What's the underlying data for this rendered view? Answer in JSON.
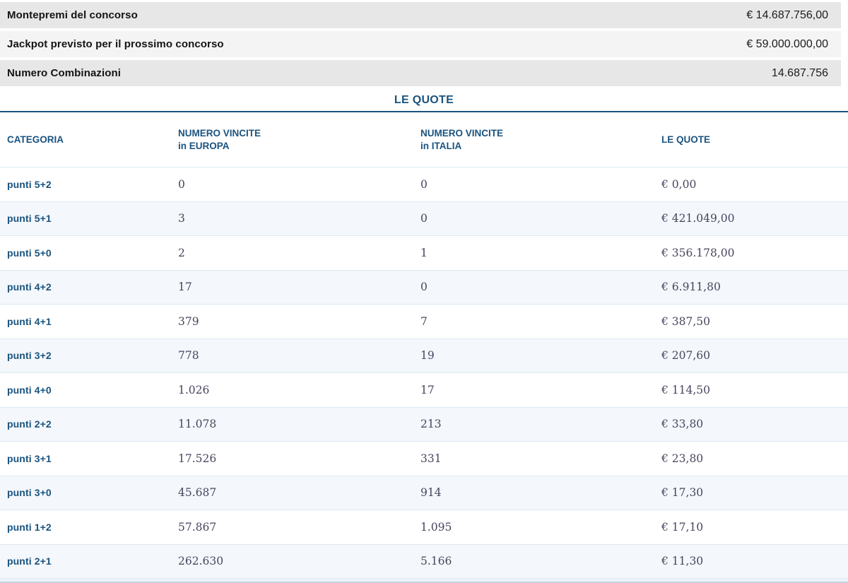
{
  "summary": {
    "rows": [
      {
        "label": "Montepremi del concorso",
        "value": "€ 14.687.756,00"
      },
      {
        "label": "Jackpot previsto per il prossimo concorso",
        "value": "€ 59.000.000,00"
      },
      {
        "label": "Numero Combinazioni",
        "value": "14.687.756"
      }
    ]
  },
  "quote_section": {
    "title": "LE QUOTE",
    "table": {
      "headers": [
        {
          "line1": "CATEGORIA",
          "line2": ""
        },
        {
          "line1": "NUMERO VINCITE",
          "line2": "in EUROPA"
        },
        {
          "line1": "NUMERO VINCITE",
          "line2": "in ITALIA"
        },
        {
          "line1": "LE QUOTE",
          "line2": ""
        }
      ],
      "rows": [
        {
          "categoria": "punti 5+2",
          "europa": "0",
          "italia": "0",
          "quota": "€ 0,00"
        },
        {
          "categoria": "punti 5+1",
          "europa": "3",
          "italia": "0",
          "quota": "€ 421.049,00"
        },
        {
          "categoria": "punti 5+0",
          "europa": "2",
          "italia": "1",
          "quota": "€ 356.178,00"
        },
        {
          "categoria": "punti 4+2",
          "europa": "17",
          "italia": "0",
          "quota": "€ 6.911,80"
        },
        {
          "categoria": "punti 4+1",
          "europa": "379",
          "italia": "7",
          "quota": "€ 387,50"
        },
        {
          "categoria": "punti 3+2",
          "europa": "778",
          "italia": "19",
          "quota": "€ 207,60"
        },
        {
          "categoria": "punti 4+0",
          "europa": "1.026",
          "italia": "17",
          "quota": "€ 114,50"
        },
        {
          "categoria": "punti 2+2",
          "europa": "11.078",
          "italia": "213",
          "quota": "€ 33,80"
        },
        {
          "categoria": "punti 3+1",
          "europa": "17.526",
          "italia": "331",
          "quota": "€ 23,80"
        },
        {
          "categoria": "punti 3+0",
          "europa": "45.687",
          "italia": "914",
          "quota": "€ 17,30"
        },
        {
          "categoria": "punti 1+2",
          "europa": "57.867",
          "italia": "1.095",
          "quota": "€ 17,10"
        },
        {
          "categoria": "punti 2+1",
          "europa": "262.630",
          "italia": "5.166",
          "quota": "€ 11,30"
        }
      ]
    }
  },
  "colors": {
    "accent_blue": "#1a537f",
    "number_ink": "#46465e",
    "row_shade_dark": "#e7e7e7",
    "row_shade_light": "#f4f4f4",
    "table_row_alt": "#f4f7fb",
    "table_line": "#dde9f2"
  }
}
